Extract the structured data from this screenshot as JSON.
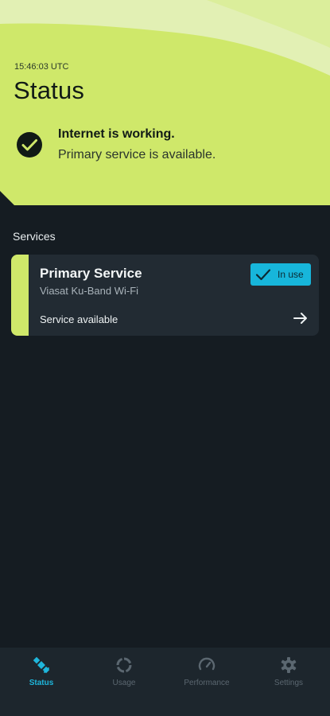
{
  "header": {
    "timestamp": "15:46:03 UTC",
    "title": "Status"
  },
  "status_message": {
    "headline": "Internet is working.",
    "detail": "Primary service is available.",
    "icon": "check-circle-icon"
  },
  "services": {
    "section_label": "Services",
    "items": [
      {
        "name": "Primary Service",
        "provider": "Viasat Ku-Band Wi-Fi",
        "availability": "Service available",
        "badge": "In use"
      }
    ]
  },
  "bottom_nav": {
    "items": [
      {
        "label": "Status",
        "icon": "satellite-icon",
        "active": true
      },
      {
        "label": "Usage",
        "icon": "usage-ring-icon",
        "active": false
      },
      {
        "label": "Performance",
        "icon": "speedometer-icon",
        "active": false
      },
      {
        "label": "Settings",
        "icon": "gear-icon",
        "active": false
      }
    ]
  },
  "colors": {
    "accent_lime": "#cfe86a",
    "accent_cyan": "#17b6db",
    "background_dark": "#151c22",
    "card_bg": "#222b33"
  }
}
